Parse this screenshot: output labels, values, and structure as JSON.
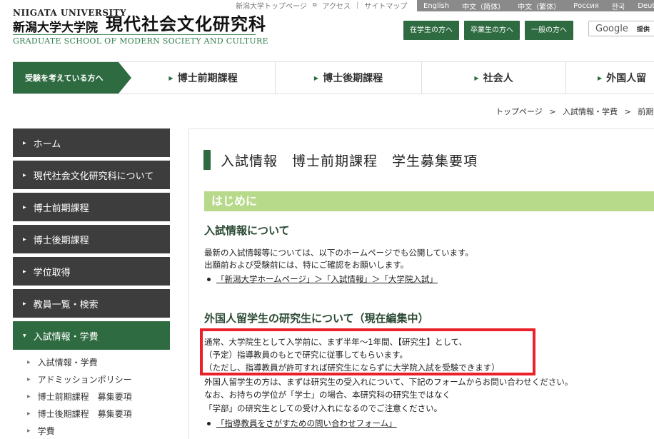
{
  "header": {
    "univ_en": "NIIGATA UNIVERSITY",
    "univ_ja": "新潟大学大学院",
    "grad_ja": "現代社会文化研究科",
    "grad_en": "GRADUATE SCHOOL OF MODERN SOCIETY AND CULTURE"
  },
  "toplinks": [
    "新潟大学トップページ",
    "アクセス",
    "サイトマップ"
  ],
  "toplink_sep": "|",
  "languages": [
    "English",
    "中文（简体）",
    "中文（繁体）",
    "Россия",
    "한국",
    "Deutsch"
  ],
  "audience": [
    "在学生の方へ",
    "卒業生の方へ",
    "一般の方へ"
  ],
  "google": {
    "logo": "Google",
    "label": "提供"
  },
  "mainnav": {
    "primary": "受験を考えている方へ",
    "items": [
      "博士前期課程",
      "博士後期課程",
      "社会人",
      "外国人留"
    ],
    "tri": "▶"
  },
  "breadcrumb": [
    "トップページ",
    "入試情報・学費",
    "前期課"
  ],
  "breadcrumb_sep": ">",
  "sidebar": {
    "items": [
      "ホーム",
      "現代社会文化研究科について",
      "博士前期課程",
      "博士後期課程",
      "学位取得",
      "教員一覧・検索",
      "入試情報・学費"
    ],
    "sub_items": [
      "入試情報・学費",
      "アドミッションポリシー",
      "博士前期課程　募集要項",
      "博士後期課程　募集要項",
      "学費"
    ],
    "tri": "▶"
  },
  "content": {
    "page_title": "入試情報　博士前期課程　学生募集要項",
    "section": "はじめに",
    "h3_1": "入試情報について",
    "p1_line1": "最新の入試情報等については、以下のホームページでも公開しています。",
    "p1_line2": "出願前および受験前には、特にご確認をお願いします。",
    "link1": "「新潟大学ホームページ」＞「入試情報」＞「大学院入試」",
    "h3_2": "外国人留学生の研究生について（現在編集中）",
    "p2_line1": "通常、大学院生として入学前に、まず半年～1年間、【研究生】として、",
    "p2_line2": "（予定）指導教員のもとで研究に従事してもらいます。",
    "p2_line3": "（ただし、指導教員が許可すれば研究生にならずに大学院入試を受験できます）",
    "p2_line4": "外国人留学生の方は、まずは研究生の受入れについて、下記のフォームからお問い合わせください。",
    "p2_line5": "なお、お持ちの学位が「学士」の場合、本研究科の研究生ではなく",
    "p2_line6": "「学部」の研究生としての受け入れになるのでご注意ください。",
    "link2": "「指導教員をさがすための問い合わせフォーム」"
  },
  "colors": {
    "brand_green": "#2e6b40",
    "section_green": "#b7d98a",
    "highlight_red": "#e8212b",
    "sidebar_dark": "#3d3d3d"
  }
}
